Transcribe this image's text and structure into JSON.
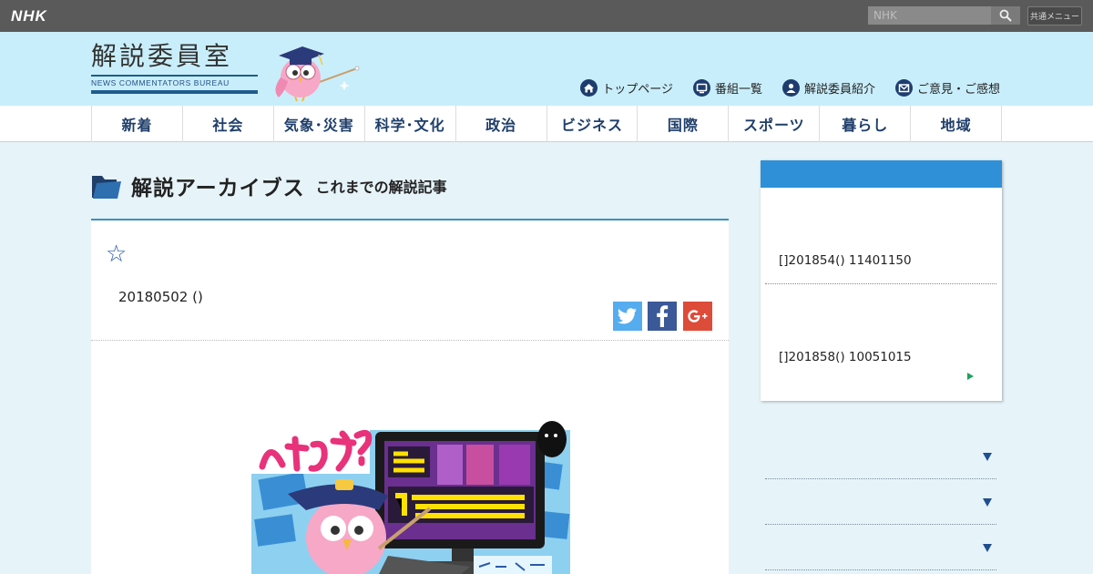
{
  "topbar": {
    "logo": "NHK",
    "search_placeholder": "NHK",
    "common_menu": "共通メニュー"
  },
  "header": {
    "title": "解説委員室",
    "subtitle": "NEWS COMMENTATORS BUREAU",
    "links": [
      {
        "label": "トップページ",
        "icon": "home-icon"
      },
      {
        "label": "番組一覧",
        "icon": "tv-icon"
      },
      {
        "label": "解説委員紹介",
        "icon": "person-icon"
      },
      {
        "label": "ご意見・ご感想",
        "icon": "mail-icon"
      }
    ]
  },
  "nav": {
    "items": [
      "新着",
      "社会",
      "気象･災害",
      "科学･文化",
      "政治",
      "ビジネス",
      "国際",
      "スポーツ",
      "暮らし",
      "地域"
    ]
  },
  "main": {
    "title": "解説アーカイブス",
    "title_sub": "これまでの解説記事",
    "star": "☆",
    "date": "20180502 ()"
  },
  "sidebar": {
    "entries": [
      "[]201854() 11401150",
      "[]201858() 10051015"
    ]
  },
  "colors": {
    "topbar": "#5a5a5a",
    "header": "#c9eefb",
    "nav_text": "#1f3e6a",
    "accent_blue": "#2f90d8",
    "page_bg": "#e6f3f9"
  }
}
